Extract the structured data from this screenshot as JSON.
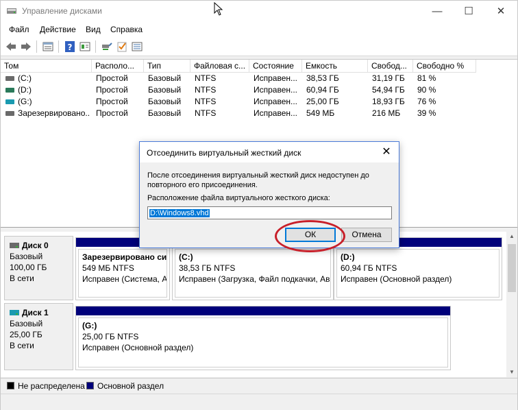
{
  "window": {
    "title": "Управление дисками",
    "minimize": "—",
    "maximize": "☐",
    "close": "✕"
  },
  "menu": [
    "Файл",
    "Действие",
    "Вид",
    "Справка"
  ],
  "toolbar_icons": [
    "back-icon",
    "forward-icon",
    "properties-icon",
    "help-icon",
    "show-hide-icon",
    "connect-icon",
    "check-icon",
    "list-icon"
  ],
  "columns": [
    "Том",
    "Располо...",
    "Тип",
    "Файловая с...",
    "Состояние",
    "Емкость",
    "Свобод...",
    "Свободно %"
  ],
  "volumes": [
    {
      "name": "(C:)",
      "layout": "Простой",
      "type": "Базовый",
      "fs": "NTFS",
      "status": "Исправен...",
      "capacity": "38,53 ГБ",
      "free": "31,19 ГБ",
      "free_pct": "81 %"
    },
    {
      "name": "(D:)",
      "layout": "Простой",
      "type": "Базовый",
      "fs": "NTFS",
      "status": "Исправен...",
      "capacity": "60,94 ГБ",
      "free": "54,94 ГБ",
      "free_pct": "90 %"
    },
    {
      "name": "(G:)",
      "layout": "Простой",
      "type": "Базовый",
      "fs": "NTFS",
      "status": "Исправен...",
      "capacity": "25,00 ГБ",
      "free": "18,93 ГБ",
      "free_pct": "76 %"
    },
    {
      "name": "Зарезервировано...",
      "layout": "Простой",
      "type": "Базовый",
      "fs": "NTFS",
      "status": "Исправен...",
      "capacity": "549 МБ",
      "free": "216 МБ",
      "free_pct": "39 %"
    }
  ],
  "disks": [
    {
      "name": "Диск 0",
      "type": "Базовый",
      "size": "100,00 ГБ",
      "state": "В сети",
      "partitions": [
        {
          "name": "Зарезервировано сис",
          "size": "549 МБ NTFS",
          "status": "Исправен (Система, Ак"
        },
        {
          "name": "(C:)",
          "size": "38,53 ГБ NTFS",
          "status": "Исправен (Загрузка, Файл подкачки, Ав"
        },
        {
          "name": "(D:)",
          "size": "60,94 ГБ NTFS",
          "status": "Исправен (Основной раздел)"
        }
      ]
    },
    {
      "name": "Диск 1",
      "type": "Базовый",
      "size": "25,00 ГБ",
      "state": "В сети",
      "partitions": [
        {
          "name": "(G:)",
          "size": "25,00 ГБ NTFS",
          "status": "Исправен (Основной раздел)"
        }
      ]
    }
  ],
  "legend": [
    {
      "label": "Не распределена",
      "color": "#000000"
    },
    {
      "label": "Основной раздел",
      "color": "#00007a"
    }
  ],
  "dialog": {
    "title": "Отсоединить виртуальный жесткий диск",
    "close": "✕",
    "message": "После отсоединения виртуальный жесткий диск недоступен до повторного его присоединения.",
    "path_label": "Расположение файла виртуального жесткого диска:",
    "path_value": "D:\\Windows8.vhd",
    "ok": "ОК",
    "cancel": "Отмена"
  },
  "colors": {
    "primary_partition": "#00007a",
    "highlight_ring": "#c8202a",
    "selection": "#0078d7"
  }
}
